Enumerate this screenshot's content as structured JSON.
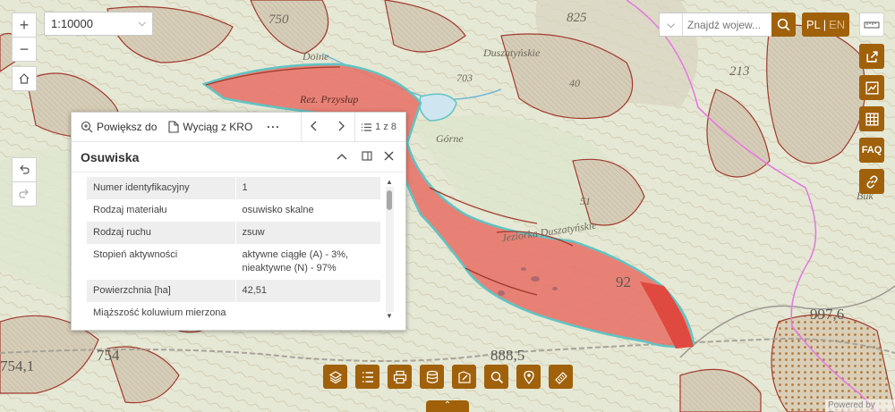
{
  "map": {
    "labels": [
      "750",
      "825",
      "213",
      "Doine",
      "Rez. Przysłup",
      "Duszatyńskie",
      "40",
      "Górne",
      "51",
      "Jeziorka Duszatyńskie",
      "92",
      "997,6",
      "888,5",
      "754,1",
      "754",
      "Buk",
      "703"
    ]
  },
  "zoom": {
    "in_symbol": "+",
    "out_symbol": "−"
  },
  "scale": {
    "value": "1:10000"
  },
  "search": {
    "placeholder": "Znajdź wojew..."
  },
  "language": {
    "pl": "PL",
    "separator": "|",
    "en": "EN"
  },
  "right_tools": [
    {
      "name": "measure-icon",
      "label": "measure"
    },
    {
      "name": "share-icon",
      "label": "share"
    },
    {
      "name": "print-map-icon",
      "label": "map"
    },
    {
      "name": "table-icon",
      "label": "table"
    },
    {
      "name": "faq-icon",
      "label": "FAQ"
    },
    {
      "name": "link-icon",
      "label": "link"
    }
  ],
  "popup": {
    "zoom_to": "Powiększ do",
    "extract": "Wyciąg z KRO",
    "more": "···",
    "paging": "1 z 8",
    "title": "Osuwiska",
    "rows": [
      {
        "key": "Numer identyfikacyjny",
        "value": "1"
      },
      {
        "key": "Rodzaj materiału",
        "value": "osuwisko skalne"
      },
      {
        "key": "Rodzaj ruchu",
        "value": "zsuw"
      },
      {
        "key": "Stopień aktywności",
        "value": "aktywne ciągłe (A) - 3%, nieaktywne (N) - 97%"
      },
      {
        "key": "Powierzchnia [ha]",
        "value": "42,51"
      },
      {
        "key": "Miąższość koluwium mierzona",
        "value": ""
      }
    ]
  },
  "bottom_tools": [
    "layers-icon",
    "legend-icon",
    "print-icon",
    "database-icon",
    "draw-icon",
    "search-tool-icon",
    "location-icon",
    "measure-tool-icon"
  ],
  "attribution": "Powered by Esri",
  "colors": {
    "accent": "#a0610a",
    "landslide_fill": "#e8766a",
    "landslide_outline": "#5fc4c4",
    "boundary_pink": "#e47ae0"
  }
}
